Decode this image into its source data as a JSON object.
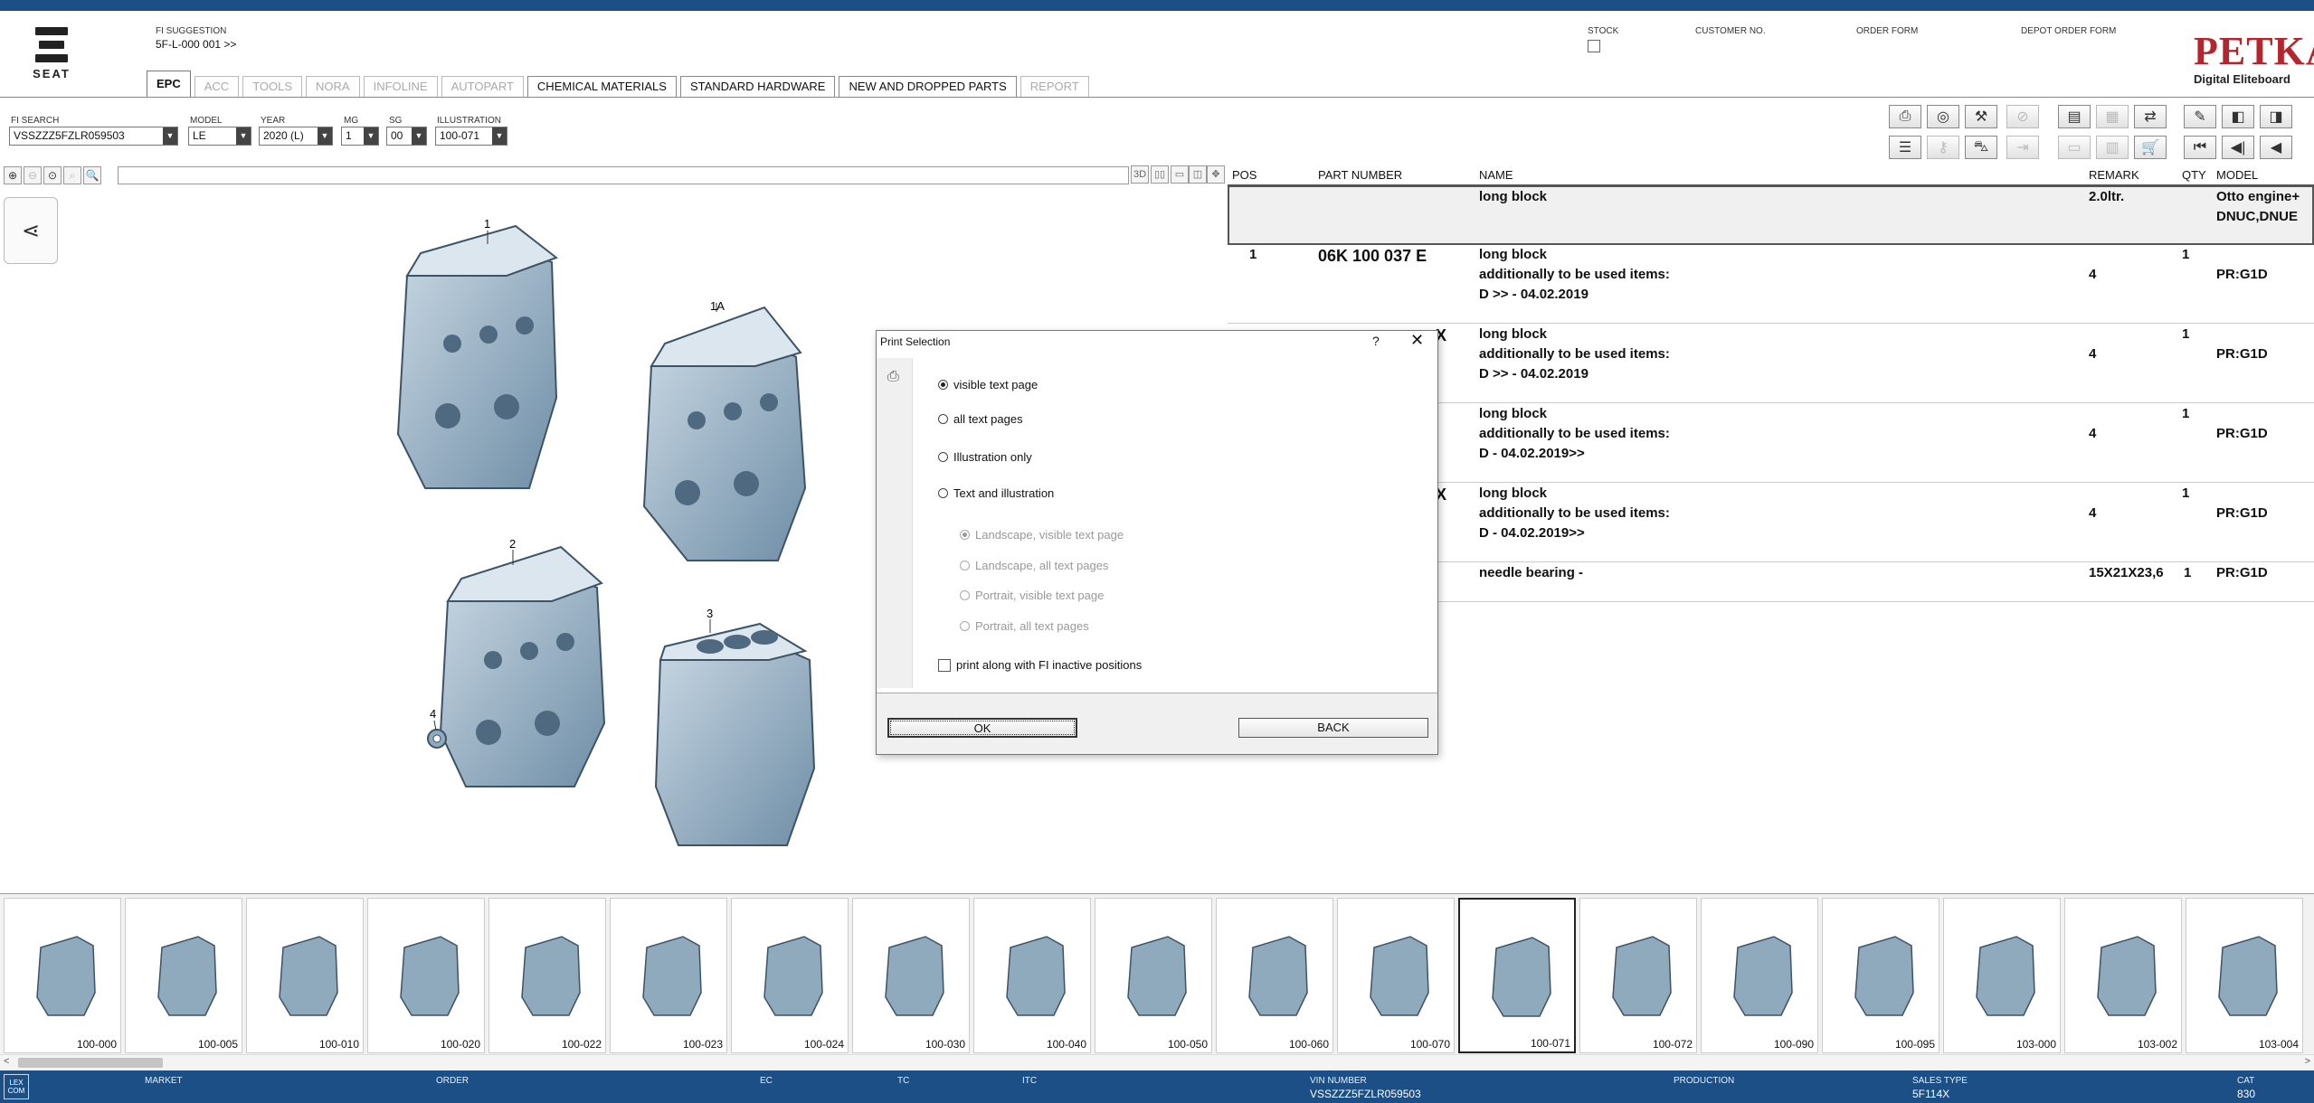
{
  "header": {
    "brand": "SEAT",
    "fi_suggestion_label": "FI SUGGESTION",
    "fi_suggestion_value": "5F-L-000 001 >>",
    "stock_label": "STOCK",
    "customer_no_label": "CUSTOMER NO.",
    "order_form_label": "ORDER FORM",
    "depot_order_form_label": "DEPOT ORDER FORM",
    "petka_title": "PETKA",
    "petka_subtitle": "Digital Eliteboard"
  },
  "tabs": [
    {
      "label": "EPC",
      "state": "active"
    },
    {
      "label": "ACC",
      "state": "disabled"
    },
    {
      "label": "TOOLS",
      "state": "disabled"
    },
    {
      "label": "NORA",
      "state": "disabled"
    },
    {
      "label": "INFOLINE",
      "state": "disabled"
    },
    {
      "label": "AUTOPART",
      "state": "disabled"
    },
    {
      "label": "CHEMICAL MATERIALS",
      "state": "enabled"
    },
    {
      "label": "STANDARD HARDWARE",
      "state": "enabled"
    },
    {
      "label": "NEW AND DROPPED PARTS",
      "state": "enabled"
    },
    {
      "label": "REPORT",
      "state": "disabled"
    }
  ],
  "filters": {
    "fi_search": {
      "label": "FI SEARCH",
      "value": "VSSZZZ5FZLR059503"
    },
    "model": {
      "label": "MODEL",
      "value": "LE"
    },
    "year": {
      "label": "YEAR",
      "value": "2020 (L)"
    },
    "mg": {
      "label": "MG",
      "value": "1"
    },
    "sg": {
      "label": "SG",
      "value": "00"
    },
    "illustration": {
      "label": "ILLUSTRATION",
      "value": "100-071"
    }
  },
  "image_toolbar": {
    "three_d": "3D"
  },
  "illustration_callouts": [
    "1",
    "1A",
    "2",
    "3",
    "4"
  ],
  "parts_table": {
    "columns": [
      "POS",
      "PART NUMBER",
      "NAME",
      "REMARK",
      "QTY",
      "MODEL"
    ],
    "rows": [
      {
        "pos": "",
        "part": "",
        "name": "long block",
        "name2": "",
        "name3": "",
        "remark": "2.0ltr.",
        "qty": "",
        "qty2": "",
        "model": "Otto engine+",
        "model2": "DNUC,DNUE"
      },
      {
        "pos": "1",
        "part": "06K 100 037 E",
        "name": "long block",
        "name2": "additionally to be used items:",
        "name3": "D            >> - 04.02.2019",
        "remark": "",
        "qty": "1",
        "qty2": "4",
        "model": "",
        "model2": "PR:G1D"
      },
      {
        "pos": "",
        "part": "X",
        "name": "long block",
        "name2": "additionally to be used items:",
        "name3": "D            >> - 04.02.2019",
        "remark": "",
        "qty": "1",
        "qty2": "4",
        "model": "",
        "model2": "PR:G1D"
      },
      {
        "pos": "",
        "part": "",
        "name": "long block",
        "name2": "additionally to be used items:",
        "name3": "D - 04.02.2019>>",
        "remark": "",
        "qty": "1",
        "qty2": "4",
        "model": "",
        "model2": "PR:G1D"
      },
      {
        "pos": "",
        "part": "X",
        "name": "long block",
        "name2": "additionally to be used items:",
        "name3": "D - 04.02.2019>>",
        "remark": "",
        "qty": "1",
        "qty2": "4",
        "model": "",
        "model2": "PR:G1D"
      },
      {
        "pos": "",
        "part": "",
        "name": "needle bearing -",
        "name2": "",
        "name3": "",
        "remark": "15X21X23,6",
        "qty": "1",
        "qty2": "",
        "model": "PR:G1D",
        "model2": ""
      }
    ]
  },
  "print_dialog": {
    "title": "Print Selection",
    "help": "?",
    "close": "✕",
    "options": [
      {
        "label": "visible text page",
        "checked": true
      },
      {
        "label": "all text pages",
        "checked": false
      },
      {
        "label": "Illustration only",
        "checked": false
      },
      {
        "label": "Text and illustration",
        "checked": false
      }
    ],
    "sub_options": [
      {
        "label": "Landscape, visible text page",
        "checked": true
      },
      {
        "label": "Landscape, all text pages",
        "checked": false
      },
      {
        "label": "Portrait, visible text page",
        "checked": false
      },
      {
        "label": "Portrait, all text pages",
        "checked": false
      }
    ],
    "checkbox_label": "print along with FI inactive positions",
    "ok_label": "OK",
    "back_label": "BACK"
  },
  "thumbnails": [
    "100-000",
    "100-005",
    "100-010",
    "100-020",
    "100-022",
    "100-023",
    "100-024",
    "100-030",
    "100-040",
    "100-050",
    "100-060",
    "100-070",
    "100-071",
    "100-072",
    "100-090",
    "100-095",
    "103-000",
    "103-002",
    "103-004"
  ],
  "selected_thumbnail": "100-071",
  "status_bar": {
    "market_label": "MARKET",
    "order_label": "ORDER",
    "ec_label": "EC",
    "tc_label": "TC",
    "itc_label": "ITC",
    "vin_label": "VIN NUMBER",
    "vin_value": "VSSZZZ5FZLR059503",
    "production_label": "PRODUCTION",
    "sales_type_label": "SALES TYPE",
    "sales_type_value": "5F114X",
    "cat_label": "CAT",
    "cat_value": "830",
    "logo_text": "LEX COM"
  },
  "colors": {
    "brand_blue": "#1c4f86",
    "petka_red": "#b3262d",
    "engine_blue": "#8fa9bd"
  }
}
